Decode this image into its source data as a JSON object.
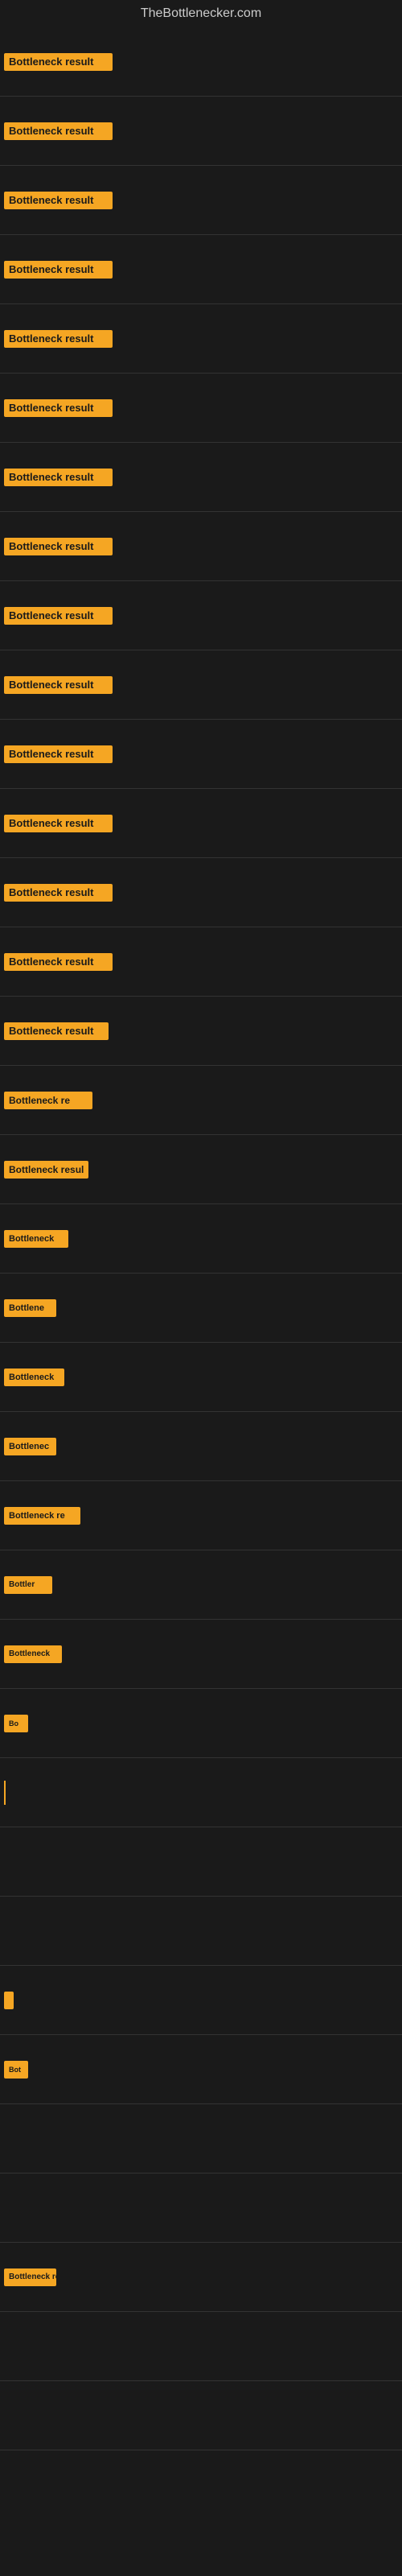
{
  "site": {
    "title": "TheBottlenecker.com"
  },
  "items": [
    {
      "id": 1,
      "label": "Bottleneck result",
      "class": "item-1"
    },
    {
      "id": 2,
      "label": "Bottleneck result",
      "class": "item-2"
    },
    {
      "id": 3,
      "label": "Bottleneck result",
      "class": "item-3"
    },
    {
      "id": 4,
      "label": "Bottleneck result",
      "class": "item-4"
    },
    {
      "id": 5,
      "label": "Bottleneck result",
      "class": "item-5"
    },
    {
      "id": 6,
      "label": "Bottleneck result",
      "class": "item-6"
    },
    {
      "id": 7,
      "label": "Bottleneck result",
      "class": "item-7"
    },
    {
      "id": 8,
      "label": "Bottleneck result",
      "class": "item-8"
    },
    {
      "id": 9,
      "label": "Bottleneck result",
      "class": "item-9"
    },
    {
      "id": 10,
      "label": "Bottleneck result",
      "class": "item-10"
    },
    {
      "id": 11,
      "label": "Bottleneck result",
      "class": "item-11"
    },
    {
      "id": 12,
      "label": "Bottleneck result",
      "class": "item-12"
    },
    {
      "id": 13,
      "label": "Bottleneck result",
      "class": "item-13"
    },
    {
      "id": 14,
      "label": "Bottleneck result",
      "class": "item-14"
    },
    {
      "id": 15,
      "label": "Bottleneck result",
      "class": "item-15"
    },
    {
      "id": 16,
      "label": "Bottleneck re",
      "class": "item-16"
    },
    {
      "id": 17,
      "label": "Bottleneck resul",
      "class": "item-17"
    },
    {
      "id": 18,
      "label": "Bottleneck",
      "class": "item-18"
    },
    {
      "id": 19,
      "label": "Bottlene",
      "class": "item-19"
    },
    {
      "id": 20,
      "label": "Bottleneck",
      "class": "item-20"
    },
    {
      "id": 21,
      "label": "Bottlenec",
      "class": "item-21"
    },
    {
      "id": 22,
      "label": "Bottleneck re",
      "class": "item-22"
    },
    {
      "id": 23,
      "label": "Bottler",
      "class": "item-23"
    },
    {
      "id": 24,
      "label": "Bottleneck",
      "class": "item-24"
    },
    {
      "id": 25,
      "label": "Bo",
      "class": "item-25"
    },
    {
      "id": 26,
      "label": "|",
      "class": "item-26"
    },
    {
      "id": 27,
      "label": "",
      "class": "item-27"
    },
    {
      "id": 28,
      "label": "",
      "class": "item-28"
    },
    {
      "id": 29,
      "label": "|",
      "class": "item-29"
    },
    {
      "id": 30,
      "label": "Bot",
      "class": "item-30"
    },
    {
      "id": 31,
      "label": "",
      "class": "item-31"
    },
    {
      "id": 32,
      "label": "",
      "class": "item-32"
    },
    {
      "id": 33,
      "label": "Bottleneck re",
      "class": "item-33"
    },
    {
      "id": 34,
      "label": "",
      "class": "item-34"
    },
    {
      "id": 35,
      "label": "",
      "class": "item-35"
    },
    {
      "id": 36,
      "label": "",
      "class": "item-36"
    }
  ]
}
